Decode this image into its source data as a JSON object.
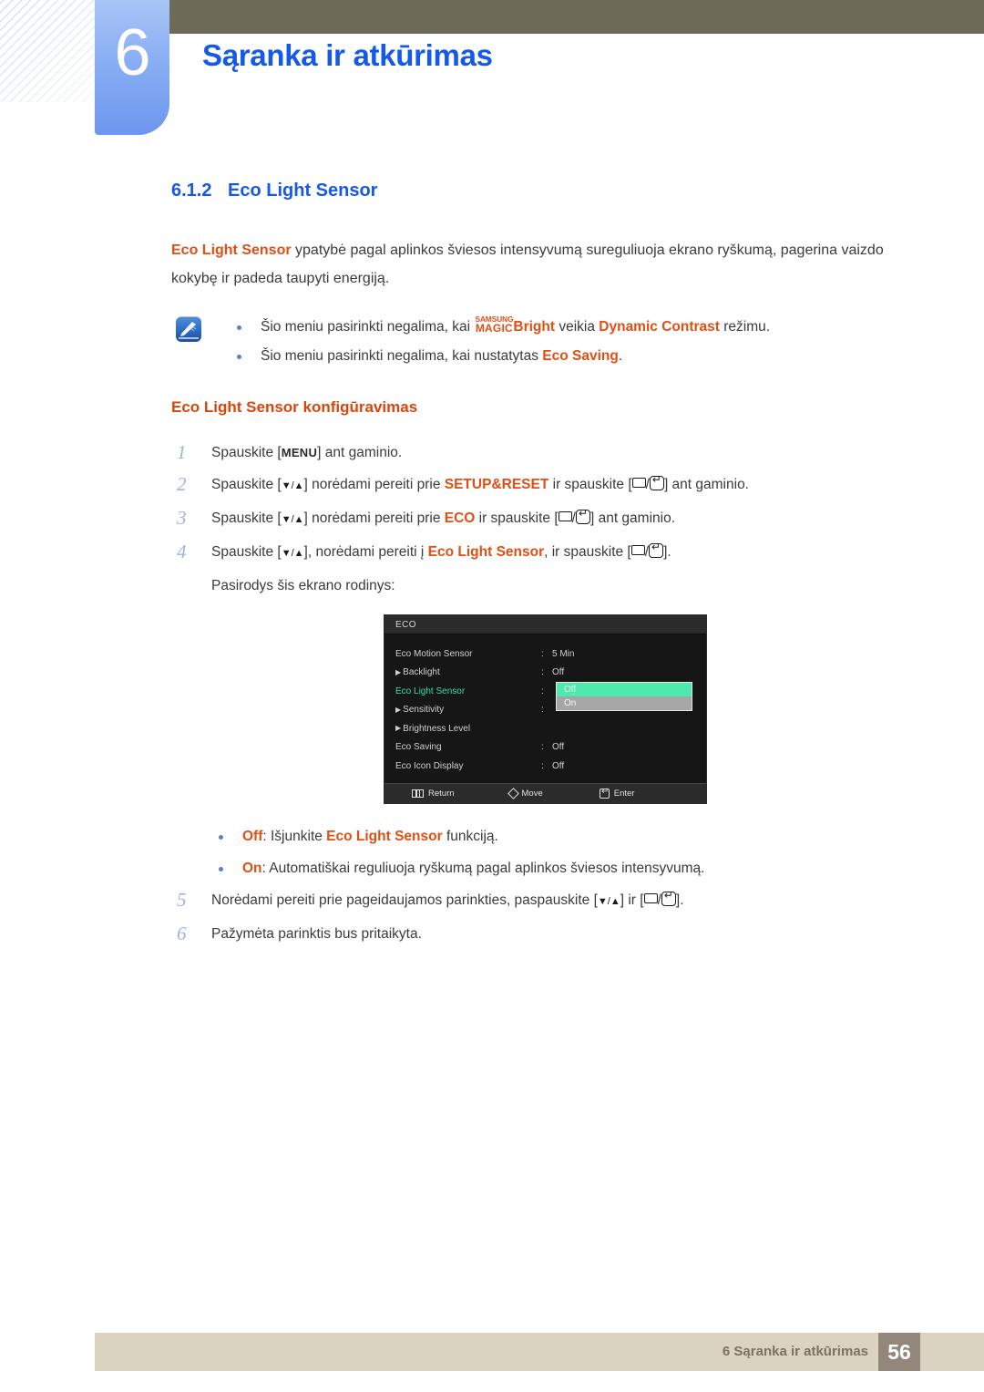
{
  "header": {
    "chapter_number": "6",
    "chapter_title": "Sąranka ir atkūrimas",
    "accent_blue": "#1559e8",
    "olive": "#6d6b57"
  },
  "section": {
    "number": "6.1.2",
    "title": "Eco Light Sensor"
  },
  "intro": {
    "keyword": "Eco Light Sensor",
    "rest": " ypatybė pagal aplinkos šviesos intensyvumą sureguliuoja ekrano ryškumą, pagerina vaizdo kokybę ir padeda taupyti energiją."
  },
  "note": {
    "icon": "note-pen-icon",
    "items": [
      {
        "pre": "Šio meniu pasirinkti negalima, kai ",
        "magic_top": "SAMSUNG",
        "magic_bottom": "MAGIC",
        "magic_suffix": "Bright",
        "mid": " veikia ",
        "kw": "Dynamic Contrast",
        "post": " režimu."
      },
      {
        "pre": "Šio meniu pasirinkti negalima, kai nustatytas ",
        "kw": "Eco Saving",
        "post": "."
      }
    ]
  },
  "sub_heading": "Eco Light Sensor konfigūravimas",
  "steps": [
    {
      "num": "1",
      "parts": [
        {
          "t": "Spauskite ["
        },
        {
          "t": "MENU",
          "style": "key-menu"
        },
        {
          "t": "] ant gaminio."
        }
      ]
    },
    {
      "num": "2",
      "parts": [
        {
          "t": "Spauskite ["
        },
        {
          "t": "▼/▲",
          "style": "key-arrows"
        },
        {
          "t": "] norėdami pereiti prie "
        },
        {
          "t": "SETUP&RESET",
          "style": "kw"
        },
        {
          "t": " ir spauskite ["
        },
        {
          "t": "",
          "style": "key-box"
        },
        {
          "t": "/"
        },
        {
          "t": "",
          "style": "key-enter"
        },
        {
          "t": "] ant gaminio."
        }
      ]
    },
    {
      "num": "3",
      "parts": [
        {
          "t": "Spauskite ["
        },
        {
          "t": "▼/▲",
          "style": "key-arrows"
        },
        {
          "t": "] norėdami pereiti prie "
        },
        {
          "t": "ECO",
          "style": "kw"
        },
        {
          "t": " ir spauskite ["
        },
        {
          "t": "",
          "style": "key-box"
        },
        {
          "t": "/"
        },
        {
          "t": "",
          "style": "key-enter"
        },
        {
          "t": "] ant gaminio."
        }
      ]
    },
    {
      "num": "4",
      "parts": [
        {
          "t": "Spauskite ["
        },
        {
          "t": "▼/▲",
          "style": "key-arrows"
        },
        {
          "t": "], norėdami pereiti į "
        },
        {
          "t": "Eco Light Sensor",
          "style": "kw"
        },
        {
          "t": ", ir spauskite ["
        },
        {
          "t": "",
          "style": "key-box"
        },
        {
          "t": "/"
        },
        {
          "t": "",
          "style": "key-enter"
        },
        {
          "t": "]."
        }
      ]
    }
  ],
  "step4_followup": "Pasirodys šis ekrano rodinys:",
  "osd": {
    "title": "ECO",
    "rows": [
      {
        "label": "Eco Motion Sensor",
        "arrow": false,
        "colon": ":",
        "value": "5 Min",
        "selected": false
      },
      {
        "label": "Backlight",
        "arrow": true,
        "colon": ":",
        "value": "Off",
        "selected": false
      },
      {
        "label": "Eco Light Sensor",
        "arrow": false,
        "colon": ":",
        "value": "",
        "selected": true
      },
      {
        "label": "Sensitivity",
        "arrow": true,
        "colon": ":",
        "value": "",
        "selected": false
      },
      {
        "label": "Brightness Level",
        "arrow": true,
        "colon": "",
        "value": "",
        "selected": false
      },
      {
        "label": "Eco Saving",
        "arrow": false,
        "colon": ":",
        "value": "Off",
        "selected": false
      },
      {
        "label": "Eco Icon Display",
        "arrow": false,
        "colon": ":",
        "value": "Off",
        "selected": false
      }
    ],
    "dropdown": {
      "highlighted": "Off",
      "other": "On",
      "highlight_color": "#4fe9b0",
      "other_color": "#a6a6a6"
    },
    "footer": {
      "return_label": "Return",
      "move_label": "Move",
      "enter_label": "Enter",
      "return_icon": "menu-bars-icon",
      "move_icon": "diamond-dpad-icon",
      "enter_icon": "enter-key-icon"
    }
  },
  "options": [
    {
      "kw": "Off",
      "post": ": Išjunkite ",
      "kw2": "Eco Light Sensor",
      "post2": " funkciją."
    },
    {
      "kw": "On",
      "post": ": Automatiškai reguliuoja ryškumą pagal aplinkos šviesos intensyvumą.",
      "kw2": "",
      "post2": ""
    }
  ],
  "steps_tail": [
    {
      "num": "5",
      "parts": [
        {
          "t": "Norėdami pereiti prie pageidaujamos parinkties, paspauskite ["
        },
        {
          "t": "▼/▲",
          "style": "key-arrows"
        },
        {
          "t": "] ir ["
        },
        {
          "t": "",
          "style": "key-box"
        },
        {
          "t": "/"
        },
        {
          "t": "",
          "style": "key-enter"
        },
        {
          "t": "]."
        }
      ]
    },
    {
      "num": "6",
      "parts": [
        {
          "t": "Pažymėta parinktis bus pritaikyta."
        }
      ]
    }
  ],
  "footer": {
    "text": "6 Sąranka ir atkūrimas",
    "page_number": "56",
    "bar_color": "#d9d3c0",
    "page_box_color": "#93877b"
  }
}
